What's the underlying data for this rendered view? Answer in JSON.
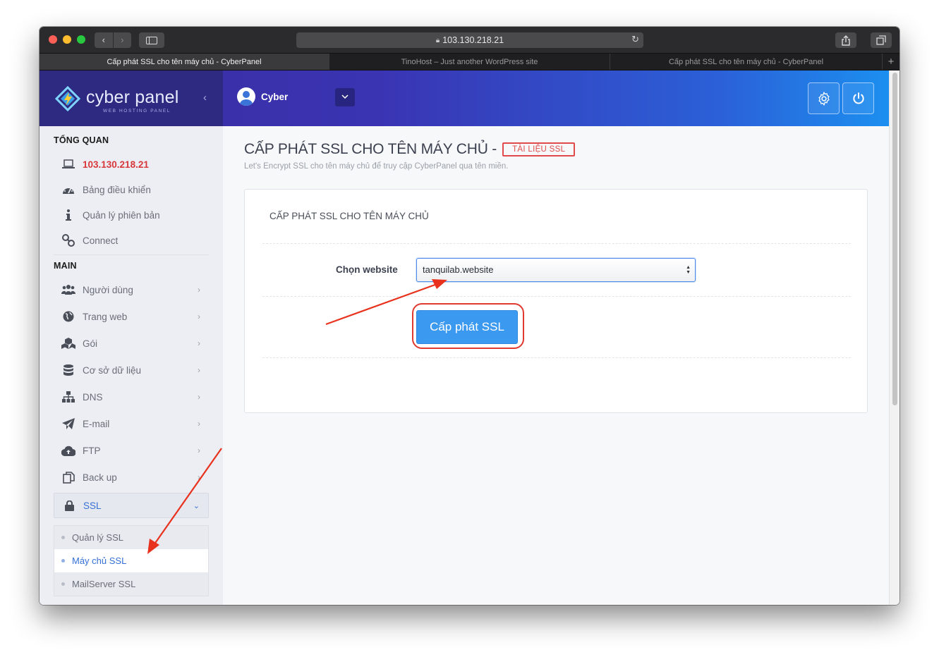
{
  "browser": {
    "url": "103.130.218.21",
    "tabs": [
      {
        "label": "Cấp phát SSL cho tên máy chủ - CyberPanel",
        "active": true
      },
      {
        "label": "TinoHost – Just another WordPress site",
        "active": false
      },
      {
        "label": "Cấp phát SSL cho tên máy chủ - CyberPanel",
        "active": false
      }
    ],
    "new_tab": "+"
  },
  "brand": {
    "name": "cyber panel",
    "tagline": "WEB HOSTING PANEL",
    "collapse": "‹"
  },
  "header": {
    "user_name": "Cyber",
    "dropdown": "⌄"
  },
  "nav": {
    "section_overview": "TỔNG QUAN",
    "ip": "103.130.218.21",
    "dashboard": "Bảng điều khiển",
    "version": "Quản lý phiên bản",
    "connect": "Connect",
    "section_main": "MAIN",
    "users": "Người dùng",
    "websites": "Trang web",
    "packages": "Gói",
    "databases": "Cơ sở dữ liệu",
    "dns": "DNS",
    "email": "E-mail",
    "ftp": "FTP",
    "backup": "Back up",
    "ssl": "SSL",
    "ssl_sub": [
      "Quản lý SSL",
      "Máy chủ SSL",
      "MailServer SSL"
    ]
  },
  "main": {
    "title": "CẤP PHÁT SSL CHO TÊN MÁY CHỦ -",
    "doc_badge": "TÀI LIỆU SSL",
    "subtitle": "Let's Encrypt SSL cho tên máy chủ để truy cập CyberPanel qua tên miền.",
    "card_title": "CẤP PHÁT SSL CHO TÊN MÁY CHỦ",
    "select_label": "Chọn website",
    "select_value": "tanquilab.website",
    "issue_button": "Cấp phát SSL"
  },
  "colors": {
    "accent": "#3c99f0",
    "alert_red": "#e03a30",
    "header_start": "#3b2c9e",
    "header_end": "#1c8ff0"
  }
}
